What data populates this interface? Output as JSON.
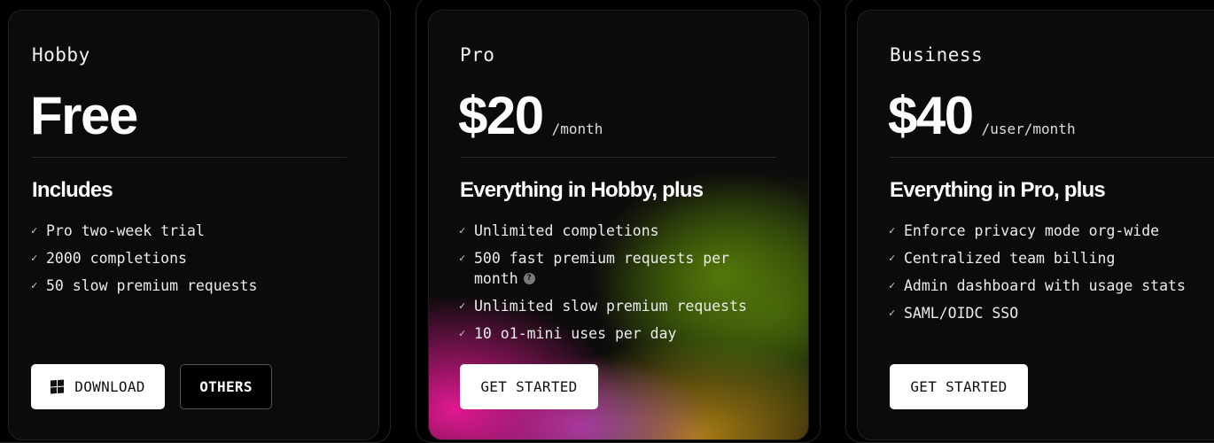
{
  "colors": {
    "background": "#000000",
    "card": "#0b0b0b",
    "text": "#f4f4f4",
    "button_light": "#ffffff",
    "button_dark": "#000000"
  },
  "plans": {
    "hobby": {
      "name": "Hobby",
      "price": "Free",
      "section_title": "Includes",
      "features": [
        "Pro two-week trial",
        "2000 completions",
        "50 slow premium requests"
      ],
      "download_label": "DOWNLOAD",
      "download_icon": "windows-icon",
      "others_label": "OTHERS"
    },
    "pro": {
      "name": "Pro",
      "price": "$20",
      "price_unit": "/month",
      "section_title": "Everything in Hobby, plus",
      "features": [
        "Unlimited completions",
        "500 fast premium requests per",
        "month",
        "Unlimited slow premium requests",
        "10 o1-mini uses per day"
      ],
      "info_icon": "info-icon",
      "info_glyph": "?",
      "cta_label": "GET STARTED"
    },
    "business": {
      "name": "Business",
      "price": "$40",
      "price_unit": "/user/month",
      "section_title": "Everything in Pro, plus",
      "features": [
        "Enforce privacy mode org-wide",
        "Centralized team billing",
        "Admin dashboard with usage stats",
        "SAML/OIDC SSO"
      ],
      "cta_label": "GET STARTED"
    }
  },
  "check_glyph": "✓"
}
